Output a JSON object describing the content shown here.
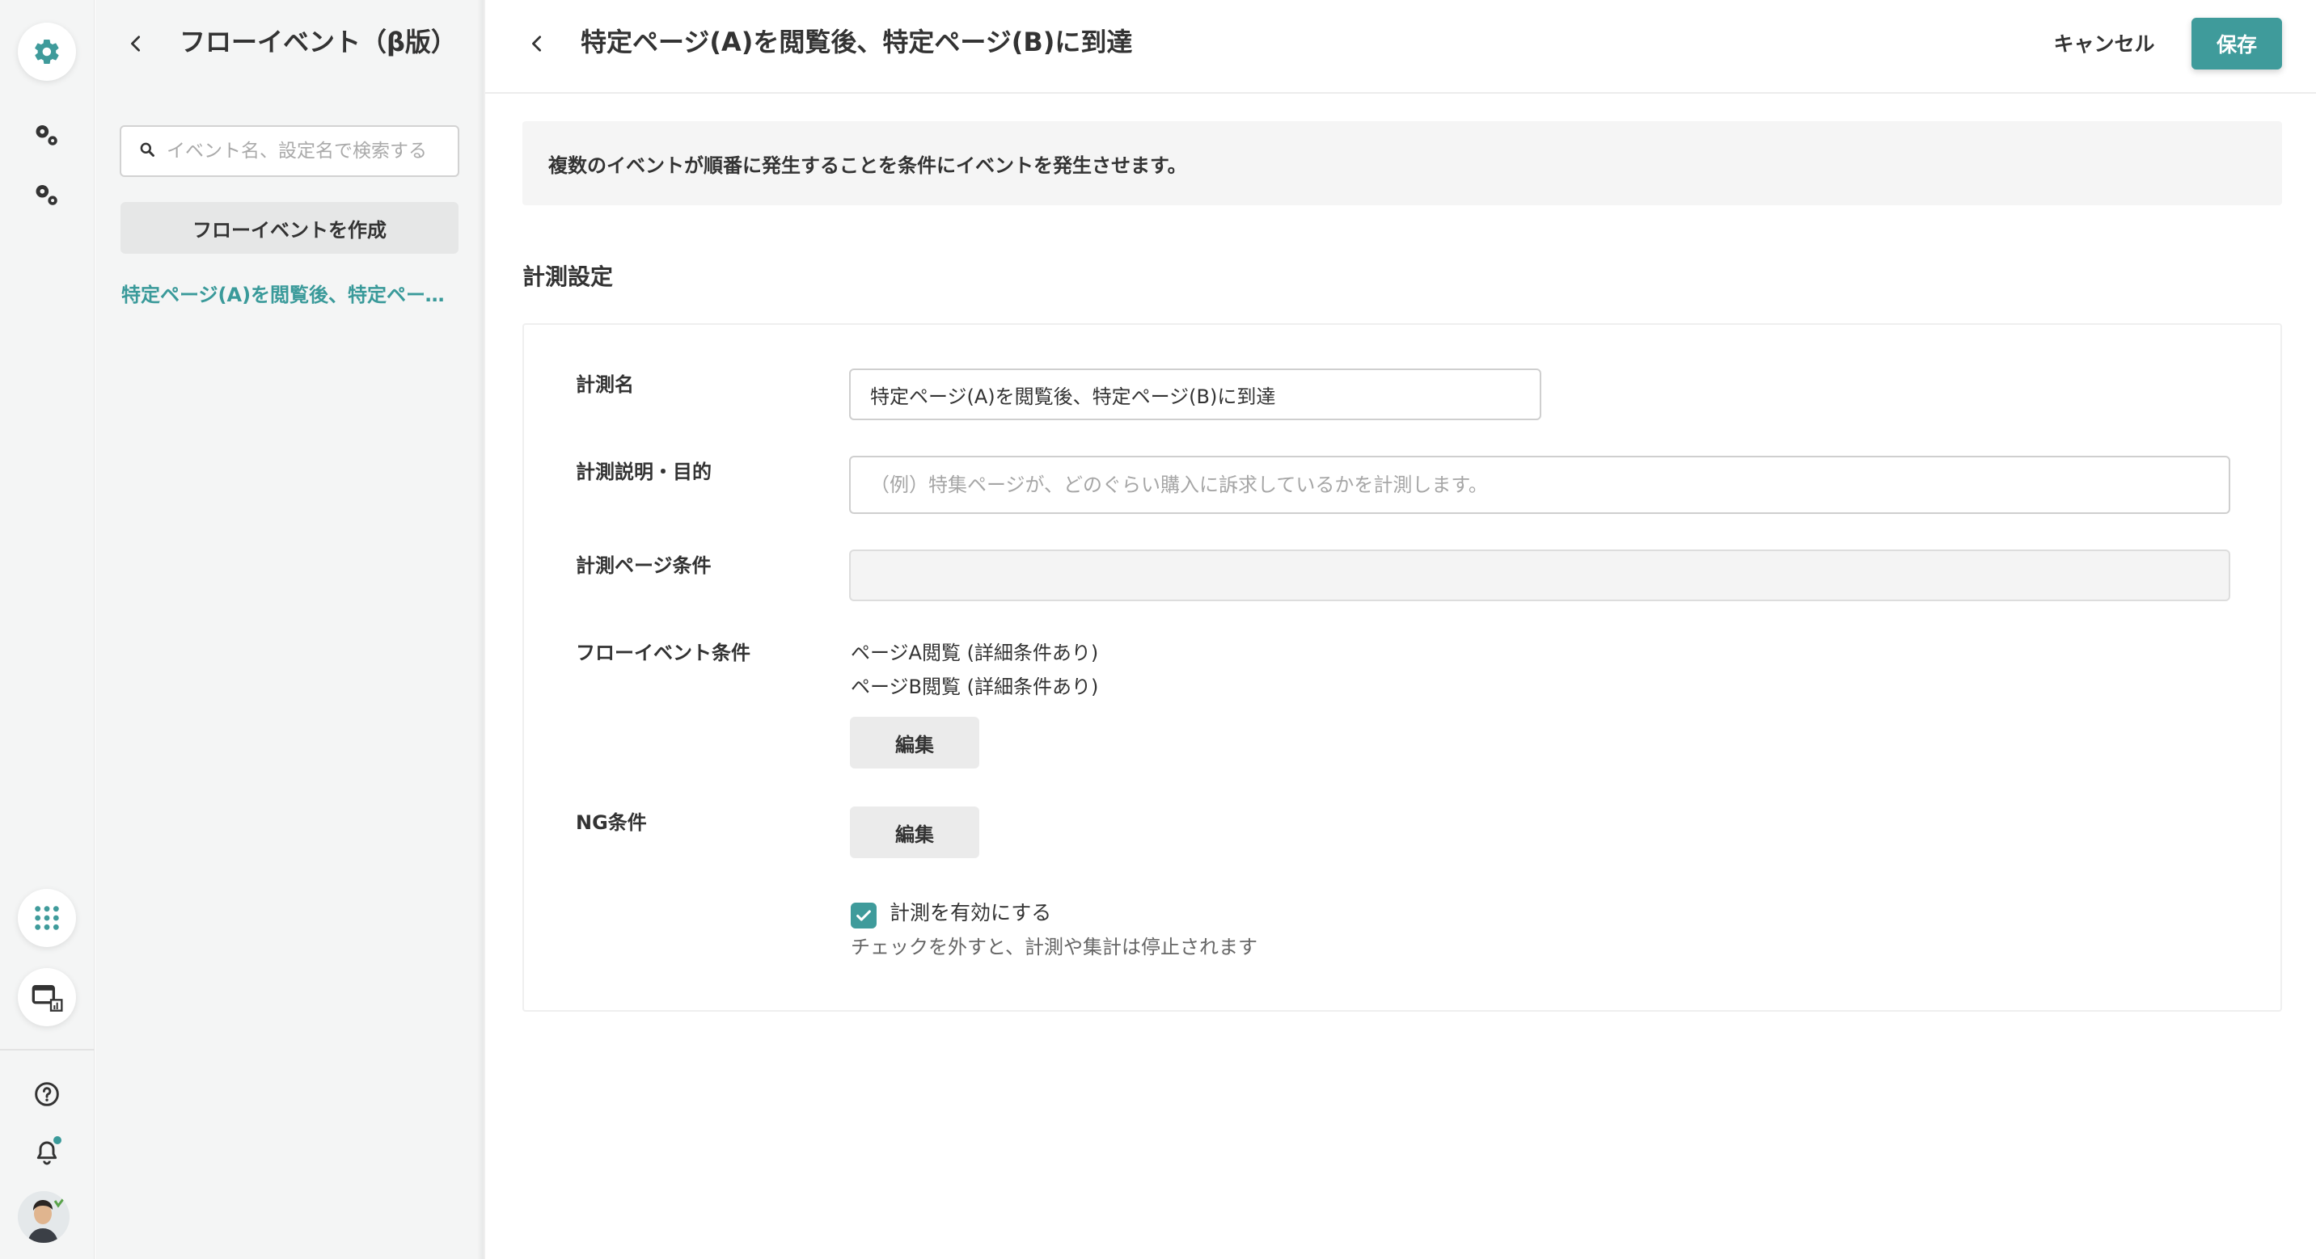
{
  "rail": {
    "icons": [
      "settings-gear-icon",
      "gears-icon",
      "gears-icon",
      "apps-grid-icon",
      "window-chart-icon",
      "help-icon",
      "bell-icon",
      "avatar"
    ]
  },
  "sidebar": {
    "title": "フローイベント（β版）",
    "search_placeholder": "イベント名、設定名で検索する",
    "create_button": "フローイベントを作成",
    "items": [
      {
        "label": "特定ページ(A)を閲覧後、特定ページ(B)に到達",
        "selected": true
      }
    ]
  },
  "header": {
    "title": "特定ページ(A)を閲覧後、特定ページ(B)に到達",
    "cancel_label": "キャンセル",
    "save_label": "保存"
  },
  "main": {
    "description": "複数のイベントが順番に発生することを条件にイベントを発生させます。",
    "section_title": "計測設定",
    "form": {
      "name_label": "計測名",
      "name_value": "特定ページ(A)を閲覧後、特定ページ(B)に到達",
      "purpose_label": "計測説明・目的",
      "purpose_placeholder": "（例）特集ページが、どのぐらい購入に訴求しているかを計測します。",
      "page_condition_label": "計測ページ条件",
      "page_condition_value": "",
      "flow_condition_label": "フローイベント条件",
      "flow_conditions": [
        "ページA閲覧 (詳細条件あり)",
        "ページB閲覧 (詳細条件あり)"
      ],
      "flow_edit_label": "編集",
      "ng_condition_label": "NG条件",
      "ng_edit_label": "編集",
      "enable_label": "計測を有効にする",
      "enable_checked": true,
      "enable_help": "チェックを外すと、計測や集計は停止されます"
    }
  },
  "colors": {
    "accent": "#3f9b9b",
    "sidebar_bg": "#f4f5f5"
  }
}
